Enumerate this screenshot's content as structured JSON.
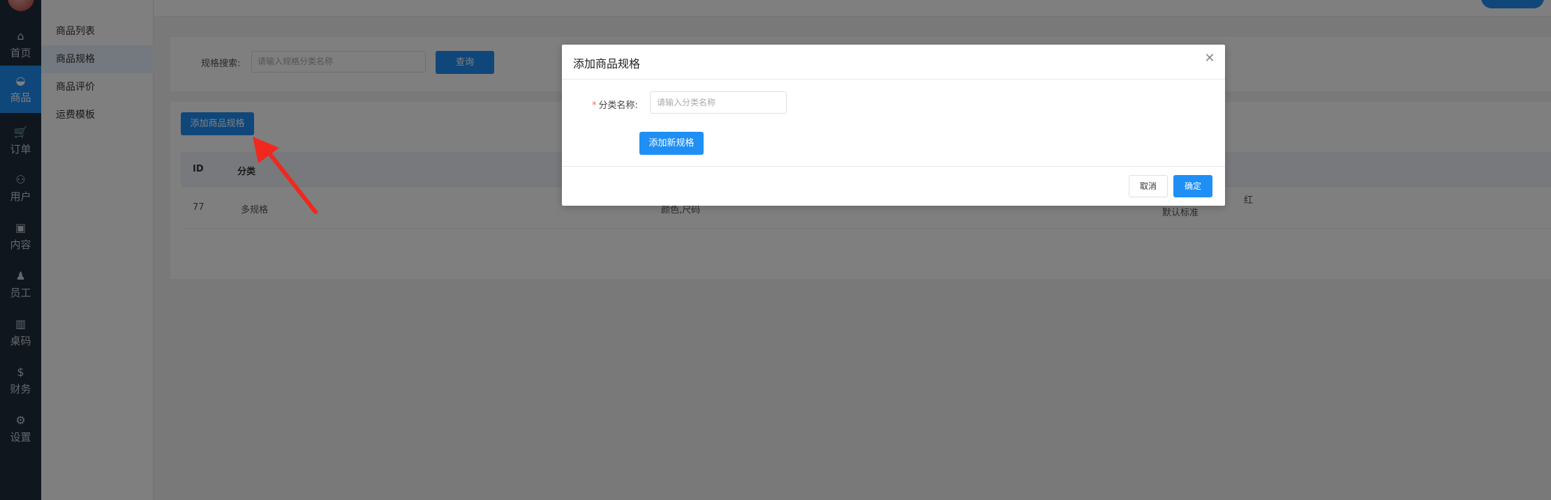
{
  "app": {
    "rail": [
      {
        "label": "首页",
        "icon": "home-icon",
        "glyph": "⌂"
      },
      {
        "label": "商品",
        "icon": "basket-icon",
        "glyph": "◒",
        "active": true
      },
      {
        "label": "订单",
        "icon": "cart-icon",
        "glyph": "🛒"
      },
      {
        "label": "用户",
        "icon": "users-icon",
        "glyph": "⚇"
      },
      {
        "label": "内容",
        "icon": "briefcase-icon",
        "glyph": "▣"
      },
      {
        "label": "员工",
        "icon": "person-icon",
        "glyph": "♟"
      },
      {
        "label": "桌码",
        "icon": "map-icon",
        "glyph": "▥"
      },
      {
        "label": "财务",
        "icon": "dollar-icon",
        "glyph": "$"
      },
      {
        "label": "设置",
        "icon": "gear-icon",
        "glyph": "⚙"
      }
    ],
    "subnav": [
      {
        "label": "商品列表"
      },
      {
        "label": "商品规格",
        "active": true
      },
      {
        "label": "商品评价"
      },
      {
        "label": "运费模板"
      }
    ],
    "search": {
      "label": "规格搜索:",
      "placeholder": "请输入规格分类名称",
      "button": "查询"
    },
    "table": {
      "add_button": "添加商品规格",
      "columns": [
        "ID",
        "分类"
      ],
      "rows": [
        {
          "id": "77",
          "category": "多规格",
          "specs": "颜色,尺码",
          "values_line1": "红",
          "values_line2": "默认标准"
        }
      ]
    },
    "colors": {
      "primary": "#1f8ff5",
      "rail_bg": "#1f2d3d",
      "required": "#f56c6c"
    }
  },
  "modal": {
    "title": "添加商品规格",
    "close_icon": "close-icon",
    "field_label": "分类名称:",
    "field_required_mark": "*",
    "field_placeholder": "请输入分类名称",
    "add_spec_button": "添加新规格",
    "cancel": "取消",
    "confirm": "确定"
  }
}
